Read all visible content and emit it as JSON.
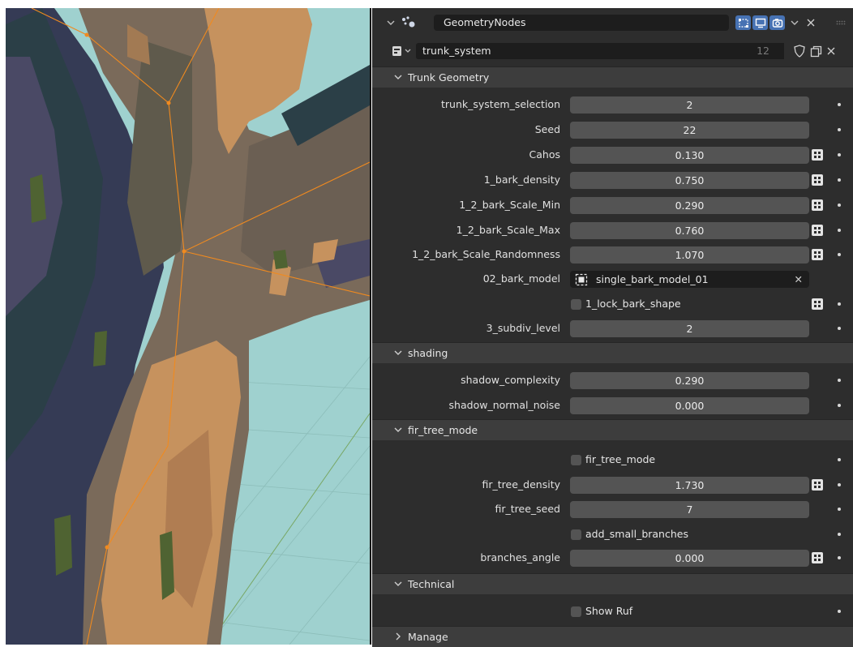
{
  "modifier": {
    "name": "GeometryNodes",
    "icon": "geometry-nodes-icon",
    "visibility_icons": [
      "edit-mode-icon",
      "viewport-icon",
      "render-camera-icon"
    ],
    "accent_color": "#4772b3"
  },
  "node_group": {
    "name": "trunk_system",
    "user_count": "12"
  },
  "panels": {
    "trunk_geometry": {
      "title": "Trunk Geometry",
      "rows": {
        "trunk_system_selection": {
          "label": "trunk_system_selection",
          "value": "2"
        },
        "seed": {
          "label": "Seed",
          "value": "22"
        },
        "cahos": {
          "label": "Cahos",
          "value": "0.130"
        },
        "bark_density": {
          "label": "1_bark_density",
          "value": "0.750"
        },
        "scale_min": {
          "label": "1_2_bark_Scale_Min",
          "value": "0.290"
        },
        "scale_max": {
          "label": "1_2_bark_Scale_Max",
          "value": "0.760"
        },
        "scale_rand": {
          "label": "1_2_bark_Scale_Randomness",
          "value": "1.070"
        },
        "bark_model": {
          "label": "02_bark_model",
          "value": "single_bark_model_01"
        },
        "lock_bark_shape": {
          "label": "1_lock_bark_shape",
          "checked": false
        },
        "subdiv_level": {
          "label": "3_subdiv_level",
          "value": "2"
        }
      }
    },
    "shading": {
      "title": "shading",
      "rows": {
        "shadow_complexity": {
          "label": "shadow_complexity",
          "value": "0.290"
        },
        "shadow_normal_noise": {
          "label": "shadow_normal_noise",
          "value": "0.000"
        }
      }
    },
    "fir_tree_mode": {
      "title": "fir_tree_mode",
      "rows": {
        "fir_tree_mode": {
          "label": "fir_tree_mode",
          "checked": false
        },
        "fir_tree_density": {
          "label": "fir_tree_density",
          "value": "1.730"
        },
        "fir_tree_seed": {
          "label": "fir_tree_seed",
          "value": "7"
        },
        "add_small_branches": {
          "label": "add_small_branches",
          "checked": false
        },
        "branches_angle": {
          "label": "branches_angle",
          "value": "0.000"
        }
      }
    },
    "technical": {
      "title": "Technical",
      "rows": {
        "show_ruf": {
          "label": "Show Ruf",
          "checked": false
        }
      }
    },
    "manage": {
      "title": "Manage",
      "collapsed": true
    }
  }
}
